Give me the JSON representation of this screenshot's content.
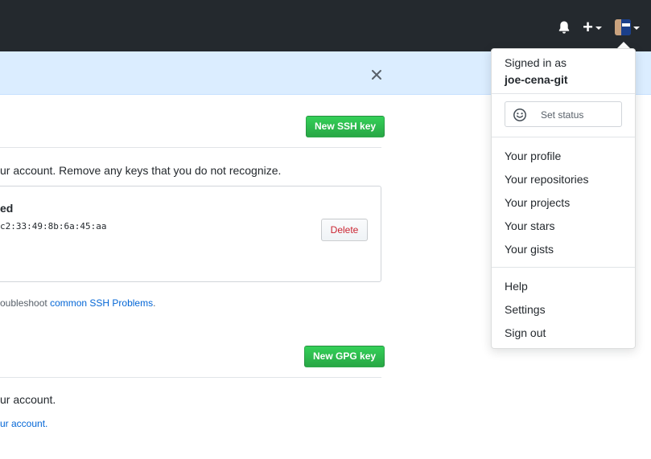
{
  "header": {
    "notifications_icon": "bell-icon",
    "new_icon": "plus-icon",
    "avatar_icon": "user-avatar"
  },
  "flash": {
    "close_icon": "close-icon"
  },
  "ssh": {
    "new_button": "New SSH key",
    "description": "ur account. Remove any keys that you do not recognize.",
    "key": {
      "title": "ed",
      "fingerprint": "c2:33:49:8b:6a:45:aa",
      "delete_label": "Delete"
    },
    "troubleshoot_prefix": "oubleshoot ",
    "troubleshoot_link": "common SSH Problems",
    "troubleshoot_suffix": "."
  },
  "gpg": {
    "new_button": "New GPG key",
    "description": "ur account.",
    "link_text": "ur account."
  },
  "user_menu": {
    "signed_in_label": "Signed in as",
    "username": "joe-cena-git",
    "set_status_label": "Set status",
    "items_a": [
      "Your profile",
      "Your repositories",
      "Your projects",
      "Your stars",
      "Your gists"
    ],
    "items_b": [
      "Help",
      "Settings",
      "Sign out"
    ]
  },
  "colors": {
    "header_bg": "#24292e",
    "flash_bg": "#dbedff",
    "primary_green": "#28a745",
    "link_blue": "#0366d6",
    "danger_red": "#cb2431"
  }
}
